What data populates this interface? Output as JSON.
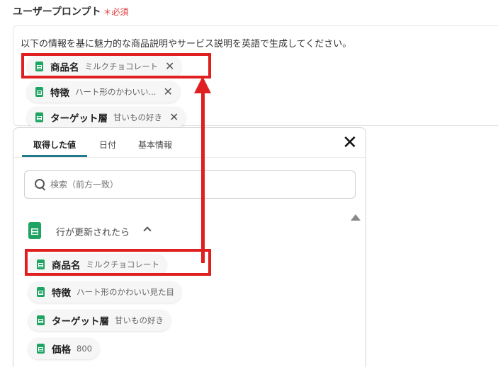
{
  "field": {
    "label": "ユーザープロンプト",
    "required_mark": "＊必須"
  },
  "prompt": {
    "text": "以下の情報を基に魅力的な商品説明やサービス説明を英語で生成してください。",
    "chips": [
      {
        "name": "商品名",
        "value": "ミルクチョコレート"
      },
      {
        "name": "特徴",
        "value": "ハート形のかわいい..."
      },
      {
        "name": "ターゲット層",
        "value": "甘いもの好き"
      }
    ]
  },
  "dropdown": {
    "tabs": [
      "取得した値",
      "日付",
      "基本情報"
    ],
    "active_tab": "取得した値",
    "search_placeholder": "検索（前方一致）",
    "group_title": "行が更新されたら",
    "items": [
      {
        "name": "商品名",
        "value": "ミルクチョコレート"
      },
      {
        "name": "特徴",
        "value": "ハート形のかわいい見た目"
      },
      {
        "name": "ターゲット層",
        "value": "甘いもの好き"
      },
      {
        "name": "価格",
        "value": "800"
      }
    ]
  },
  "colors": {
    "accent_red": "#e02020",
    "sheet_green": "#1fa463",
    "tab_underline": "#1f7a8c"
  }
}
